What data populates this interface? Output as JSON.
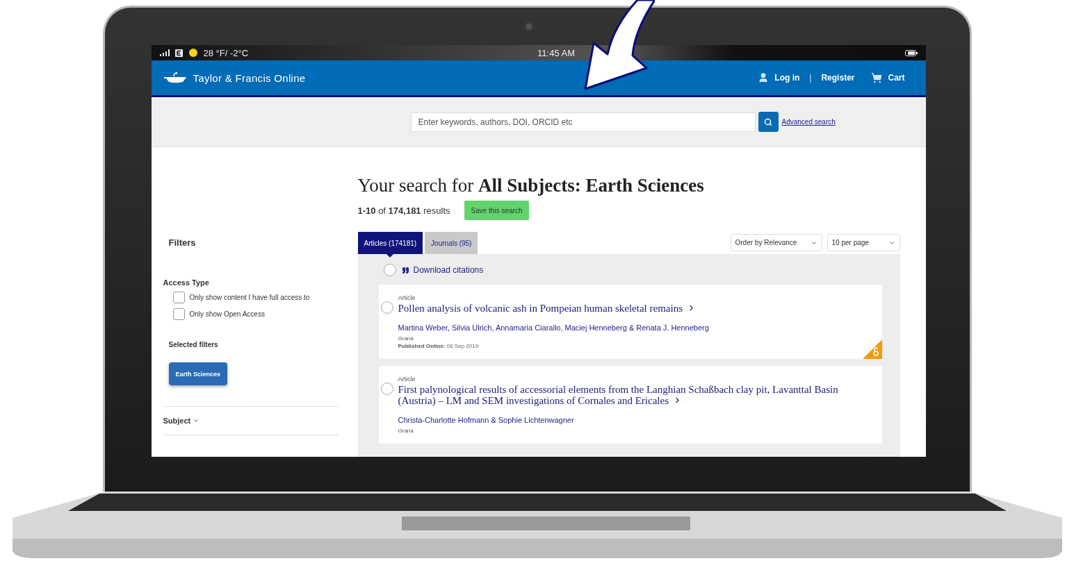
{
  "status_bar": {
    "weather": "28 °F/ -2°C",
    "time": "11:45 AM"
  },
  "header": {
    "logo": "Taylor & Francis Online",
    "links": [
      {
        "kind": "user",
        "label": "Log in"
      },
      {
        "kind": "separator",
        "label": "|"
      },
      {
        "kind": "plain",
        "label": "Register"
      },
      {
        "kind": "cart",
        "label": "Cart"
      }
    ]
  },
  "search": {
    "placeholder": "Enter keywords, authors, DOI, ORCID etc",
    "advanced_link": "Advanced search"
  },
  "sidebar": {
    "title": "Filters",
    "access_type": {
      "title": "Access Type",
      "options": [
        {
          "label": "Only show content I have full access to",
          "checked": false
        },
        {
          "label": "Only show Open Access",
          "checked": false
        }
      ]
    },
    "selected_filters": {
      "title": "Selected filters",
      "chips": [
        "Earth Sciences"
      ]
    },
    "sections": [
      {
        "label": "Subject",
        "expanded": false
      }
    ]
  },
  "main": {
    "heading": "Your search for **All Subjects: Earth Sciences**",
    "results_count": "**1-10** of **174,181** results",
    "save_button": "Save this search",
    "tabs": [
      {
        "label": "Articles (174181)",
        "selected": true
      },
      {
        "label": "Journals (95)",
        "selected": false
      }
    ],
    "dropdowns": [
      "Order by Relevance",
      "10 per page"
    ],
    "download_citations": {
      "label": "Download citations",
      "checked": false
    },
    "results": [
      {
        "type": "Article",
        "title": "Pollen analysis of volcanic ash in Pompeian human skeletal remains",
        "authors": "Martina Weber, Silvia Ulrich, Annamaria Ciarallo, Maciej Henneberg & Renata J. Henneberg",
        "journal": "Grana",
        "published_label": "Published Online:",
        "published_date": "06 Sep 2019",
        "selected": false,
        "open_access": true
      },
      {
        "type": "Article",
        "title": "First palynological results of accessorial elements from the Langhian Schaßbach clay pit, Lavanttal Basin (Austria) – LM and SEM investigations of Cornales and Ericales",
        "authors": "Christa-Charlotte Hofmann & Sophie Lichtenwagner",
        "journal": "Grana",
        "selected": false,
        "open_access": false
      }
    ]
  }
}
